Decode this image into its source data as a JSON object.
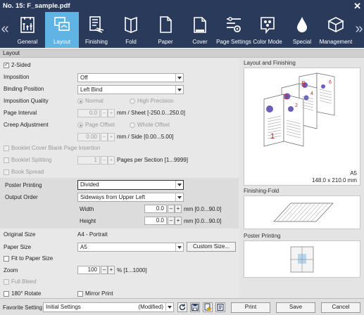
{
  "window": {
    "title": "No. 15: F_sample.pdf",
    "close_glyph": "✕"
  },
  "toolbar": {
    "prev_glyph": "«",
    "next_glyph": "»",
    "tabs": [
      {
        "label": "General",
        "icon": "general-icon"
      },
      {
        "label": "Layout",
        "icon": "layout-icon"
      },
      {
        "label": "Finishing",
        "icon": "finishing-icon"
      },
      {
        "label": "Fold",
        "icon": "fold-icon"
      },
      {
        "label": "Paper",
        "icon": "paper-icon"
      },
      {
        "label": "Cover",
        "icon": "cover-icon"
      },
      {
        "label": "Page Settings",
        "icon": "page-settings-icon"
      },
      {
        "label": "Color Mode",
        "icon": "color-mode-icon"
      },
      {
        "label": "Special",
        "icon": "special-icon"
      },
      {
        "label": "Management",
        "icon": "management-icon"
      }
    ],
    "active_tab": "Layout"
  },
  "section": {
    "title": "Layout"
  },
  "form": {
    "two_sided": {
      "label": "2-Sided",
      "checked": true,
      "check_glyph": "✓"
    },
    "imposition": {
      "label": "Imposition",
      "value": "Off"
    },
    "binding_position": {
      "label": "Binding Position",
      "value": "Left Bind"
    },
    "imposition_quality": {
      "label": "Imposition Quality",
      "options": [
        "Normal",
        "High Precision"
      ],
      "selected": "Normal"
    },
    "page_interval": {
      "label": "Page Interval",
      "value": "0.0",
      "unit": "mm / Sheet [-250.0...250.0]"
    },
    "creep_adjustment": {
      "label": "Creep Adjustment",
      "options": [
        "Page Offset",
        "Whole Offset"
      ],
      "selected": "Page Offset",
      "value": "0.00",
      "unit": "mm / Side [0.00...5.00]"
    },
    "booklet_cover_blank": {
      "label": "Booklet Cover Blank Page Insertion"
    },
    "booklet_splitting": {
      "label": "Booklet Splitting",
      "value": "1",
      "unit": "Pages per Section [1...9999]"
    },
    "book_spread": {
      "label": "Book Spread"
    },
    "poster_printing": {
      "label": "Poster Printing",
      "value": "Divided"
    },
    "output_order": {
      "label": "Output Order",
      "value": "Sideways from Upper Left"
    },
    "width": {
      "label": "Width",
      "value": "0.0",
      "unit": "mm [0.0...90.0]"
    },
    "height": {
      "label": "Height",
      "value": "0.0",
      "unit": "mm [0.0...90.0]"
    },
    "original_size": {
      "label": "Original Size",
      "value": "A4 - Portrait"
    },
    "paper_size": {
      "label": "Paper Size",
      "value": "A5",
      "custom_button": "Custom Size..."
    },
    "fit_to_paper": {
      "label": "Fit to Paper Size"
    },
    "zoom": {
      "label": "Zoom",
      "value": "100",
      "unit": "% [1...1000]"
    },
    "full_bleed": {
      "label": "Full Bleed"
    },
    "rotate_180": {
      "label": "180° Rotate"
    },
    "mirror_print": {
      "label": "Mirror Print"
    },
    "spin_minus": "–",
    "spin_plus": "+"
  },
  "preview": {
    "layout_title": "Layout and Finishing",
    "pages": [
      "1",
      "3",
      "5"
    ],
    "page_back": [
      "2",
      "4",
      "6"
    ],
    "paper_name": "A5",
    "paper_dims": "148.0 x 210.0 mm",
    "fold_title": "Finishing-Fold",
    "poster_title": "Poster Printing"
  },
  "footer": {
    "favorite_label": "Favorite Setting",
    "favorite_value": "Initial Settings",
    "modified": "(Modified)",
    "print": "Print",
    "save": "Save",
    "cancel": "Cancel"
  },
  "colors": {
    "toolbar_bg": "#2a3a5a",
    "active_tab": "#5fb4e4",
    "page_number": "#cc2222"
  }
}
